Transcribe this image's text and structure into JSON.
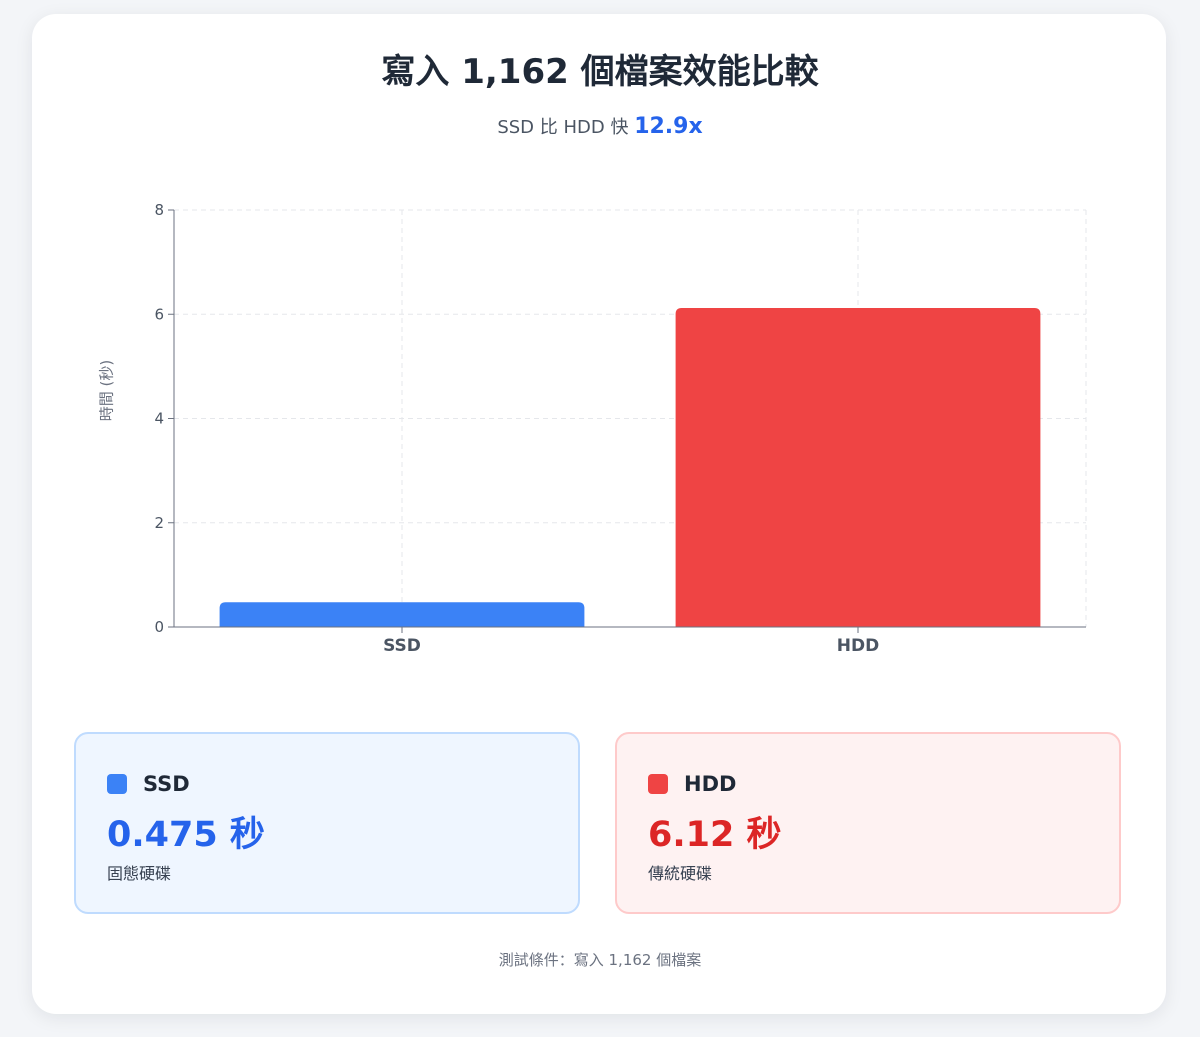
{
  "header": {
    "title": "寫入 1,162 個檔案效能比較",
    "subtitle_prefix": "SSD 比 HDD 快 ",
    "speedup": "12.9x"
  },
  "chart_data": {
    "type": "bar",
    "categories": [
      "SSD",
      "HDD"
    ],
    "values": [
      0.475,
      6.12
    ],
    "ylabel": "時間 (秒)",
    "xlabel": "",
    "ylim": [
      0,
      8
    ],
    "yticks": [
      0,
      2,
      4,
      6,
      8
    ],
    "grid": true,
    "colors": [
      "#3b82f6",
      "#ef4444"
    ]
  },
  "stats": [
    {
      "name": "SSD",
      "value": "0.475 秒",
      "desc": "固態硬碟",
      "color": "#3b82f6"
    },
    {
      "name": "HDD",
      "value": "6.12 秒",
      "desc": "傳統硬碟",
      "color": "#ef4444"
    }
  ],
  "footer": {
    "text": "測試條件：寫入 1,162 個檔案"
  }
}
